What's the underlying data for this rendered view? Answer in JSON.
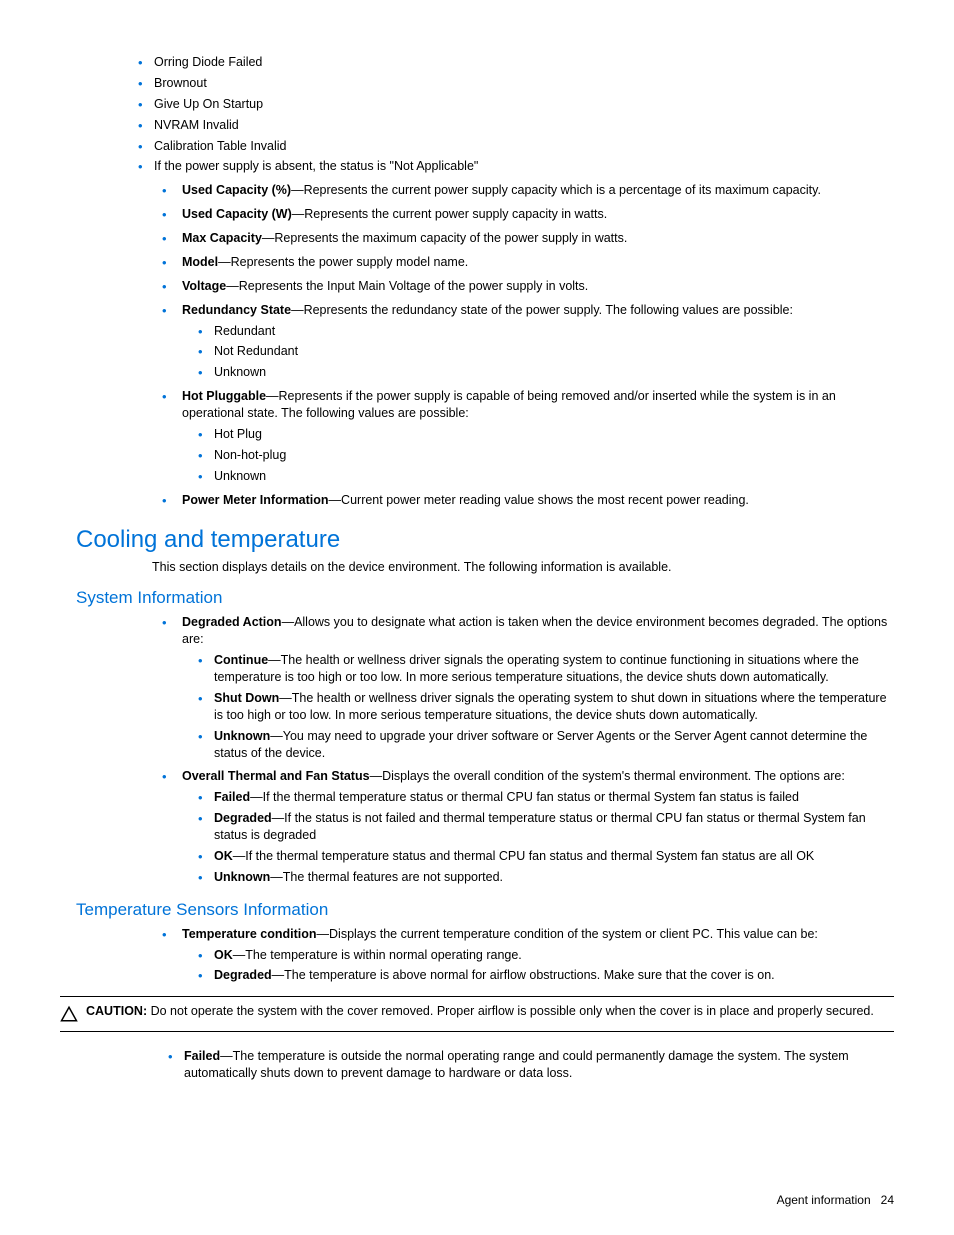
{
  "top_list_l2_a": [
    "Orring Diode Failed",
    "Brownout",
    "Give Up On Startup",
    "NVRAM Invalid",
    "Calibration Table Invalid",
    "If the power supply is absent, the status is \"Not Applicable\""
  ],
  "top_list_l1": [
    {
      "bold": "Used Capacity (%)",
      "text": "—Represents the current power supply capacity which is a  percentage of its maximum capacity."
    },
    {
      "bold": "Used Capacity (W)",
      "text": "—Represents the current power supply capacity in watts."
    },
    {
      "bold": "Max Capacity",
      "text": "—Represents the maximum capacity of the power supply in watts."
    },
    {
      "bold": "Model",
      "text": "—Represents the power supply model name."
    },
    {
      "bold": "Voltage",
      "text": "—Represents the Input Main Voltage of the power supply in volts."
    },
    {
      "bold": "Redundancy State",
      "text": "—Represents the redundancy state of the power supply.  The following values are possible:"
    }
  ],
  "redundancy_values": [
    "Redundant",
    "Not Redundant",
    "Unknown"
  ],
  "hot_pluggable": {
    "bold": "Hot Pluggable",
    "text": "—Represents if the power supply is capable of being removed and/or inserted while the system is in an operational state.  The following values are possible:"
  },
  "hot_pluggable_values": [
    "Hot Plug",
    "Non-hot-plug",
    "Unknown"
  ],
  "power_meter": {
    "bold": "Power Meter Information",
    "text": "—Current power meter reading value shows the most recent power reading."
  },
  "h1": "Cooling and temperature",
  "intro": "This section displays details on the device environment. The following information is available.",
  "h2a": "System Information",
  "sysinfo_degraded": {
    "bold": "Degraded Action",
    "text": "—Allows you to designate what action is taken when the device environment becomes degraded. The options are:"
  },
  "sysinfo_degraded_opts": [
    {
      "bold": "Continue",
      "text": "—The health or wellness driver signals the operating system to continue functioning in situations where the temperature is too high or too low. In more serious temperature situations, the device shuts down automatically."
    },
    {
      "bold": "Shut Down",
      "text": "—The health or wellness driver signals the operating system to shut down in situations where the temperature is too high or too low. In more serious temperature situations, the device shuts down automatically."
    },
    {
      "bold": "Unknown",
      "text": "—You may need to upgrade your driver software or Server Agents or the Server Agent cannot determine the status of the device."
    }
  ],
  "overall_thermal": {
    "bold": "Overall Thermal and Fan Status",
    "text": "—Displays the overall condition of the system's thermal environment. The options are:"
  },
  "overall_thermal_opts": [
    {
      "bold": "Failed",
      "text": "—If the thermal temperature status or thermal CPU fan status or thermal System fan status is failed"
    },
    {
      "bold": "Degraded",
      "text": "—If the status is not failed and thermal temperature status or thermal CPU fan status or thermal System fan status is degraded"
    },
    {
      "bold": "OK",
      "text": "—If the thermal temperature status and thermal CPU fan status and thermal System fan status are all OK"
    },
    {
      "bold": "Unknown",
      "text": "—The thermal features are not supported."
    }
  ],
  "h2b": "Temperature Sensors Information",
  "temp_cond": {
    "bold": "Temperature condition",
    "text": "—Displays the current temperature condition of the system or client PC. This value can be:"
  },
  "temp_cond_opts_pre": [
    {
      "bold": "OK",
      "text": "—The temperature is within normal operating range."
    },
    {
      "bold": "Degraded",
      "text": "—The temperature is above normal for airflow obstructions. Make sure that the cover is on."
    }
  ],
  "caution_label": "CAUTION:",
  "caution_text": "  Do not operate the system with the cover removed. Proper airflow is possible only when the cover is in place and properly secured.",
  "temp_cond_opts_post": [
    {
      "bold": "Failed",
      "text": "—The temperature is outside the normal operating range and could permanently damage the system. The system automatically shuts down to prevent damage to hardware or data loss."
    }
  ],
  "footer_label": "Agent information",
  "footer_page": "24"
}
